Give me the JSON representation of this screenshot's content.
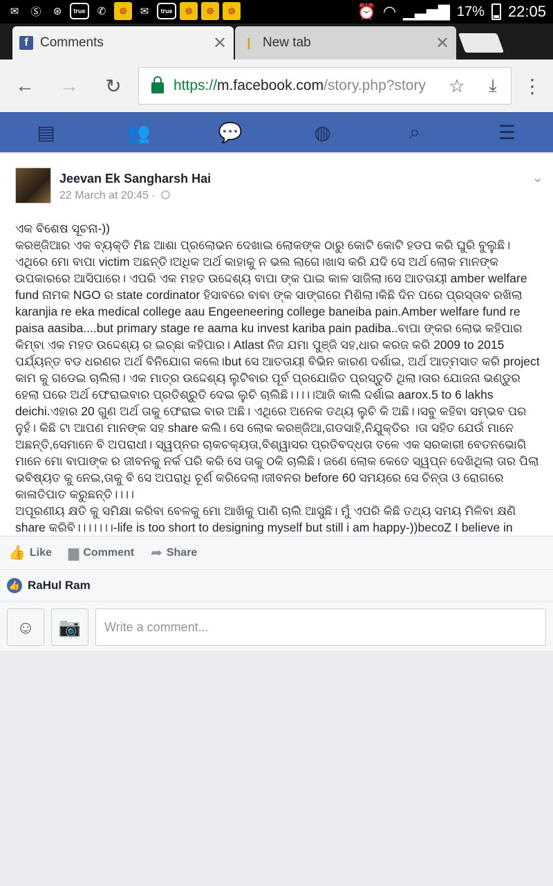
{
  "status_bar": {
    "left_icons": [
      "mail-icon",
      "s-app-icon",
      "game-icon",
      "true-icon",
      "whatsapp-icon",
      "app-icon",
      "mail-at-icon",
      "true-icon",
      "app-icon",
      "app-icon",
      "app-icon"
    ],
    "true_label": "true",
    "battery_pct": "17%",
    "time": "22:05"
  },
  "browser": {
    "tabs": [
      {
        "title": "Comments",
        "favicon": "facebook-icon",
        "active": true
      },
      {
        "title": "New tab",
        "favicon": "chrome-icon",
        "active": false
      }
    ],
    "url_scheme": "https://",
    "url_host": "m.facebook.com",
    "url_path": "/story.php?story"
  },
  "post": {
    "author": "Jeevan Ek Sangharsh Hai",
    "timestamp": "22 March at 20:45 ·",
    "paragraphs": [
      "ଏକ ବିଶେଷ ସୂଚନା-))",
      "କରଞ୍ଜିଆର ଏକ ବ୍ୟକ୍ତି ମିଛ ଆଶା ପ୍ରଲୋଭନ ଦେଖାଇ ଲୋକଙ୍କ ଠାରୁ କୋଟି କୋଟି ହଡପ କରି ଘୁରି ବୁଲୁଛି।",
      "ଏଥିରେ ମୋ ବାପା victim ଅଛନ୍ତି।ଅଧିକ ଅର୍ଥ କାହାକୁ ନ ଭଲ ଲାଗେ।ଖାସ କରି ଯଦି ସେ ଅର୍ଥ ଲୋକ ମାନଙ୍କ ଉପକାରରେ ଆସିପାରେ। ଏପରି ଏକ ମହତ ଉଦ୍ଦେଶ୍ୟ ବାପା ଙ୍କ ପାଇ କାଳ ସାଜିଲା।ସେ ଆତତାୟୀ amber welfare fund ନାମକ NGO ର state cordinator ହିସାବରେ ବାବା ଙ୍କ ସାଙ୍ଗରେ ମିଶିଲା।କିଛି ଦିନ ପରେ ପ୍ରସ୍ତାବ ରଖିଲା karanjia re eka medical college aau Engeeneering college baneiba pain.Amber welfare fund re paisa aasiba....but primary stage re aama ku invest kariba pain padiba..ବାପା ଙ୍କର ଲୋଭ କହିପାର କିମ୍ବା ଏକ ମହତ ଉଦ୍ଦେଶ୍ୟ ର ଇଚ୍ଛା କହିପାର। Atlast ନିଜ ଯମା ପୁଞ୍ଜି ସହ,ଧାର କରଜ କରି 2009 to 2015 ପର୍ଯ୍ୟନ୍ତ ବଡ ଧରଣର ଅର୍ଥ ବିନିଯୋଗ କଲେ।but ସେ ଆତତାୟୀ ବିଭିନ କାରଣ ଦର୍ଶାଇ, ଅର୍ଥ ଆତ୍ମସାତ କରି project କାମ କୁ ଗଡେଇ ଚାଲିଲା। ଏକ ମାତ୍ର ଉଦ୍ଦେଶ୍ୟ ଲୁଟିବାର ପୂର୍ବ ପ୍ରଯୋଜିତ ପ୍ରସ୍ତୁତି ଥିଲା।ତାର ଯୋଜନା ଭଣ୍ଡୁର ହେଲା ପରେ ଅର୍ଥ ଫେରାଇବାର ପ୍ରତିଶ୍ରୁତି ଦେଇ ଲୁଚି ଚାଲିଛି।।।।।ଆଜି କାଲି ଦର୍ଶାଇ aarox.5 to 6 lakhs deichi.ଏହାର 20 ଗୁଣ ଅର୍ଥ ତାକୁ ଫେରାଇ ବାର ଅଛି। ଏଥିରେ ଅନେକ ତଥ୍ୟ ଲୁଚି କି ଅଛି।।ସବୁ କହିବା ସମ୍ଭବ ପର ନୁହଁ। କିଛି ଟା ଆପଣ ମାନଙ୍କ ସହ share କଲି। ସେ ଲୋକ କରଞ୍ଜିଆ,ଗଡସାହି,ନିଯୁକ୍ତିର ।ତା ସହିତ ଯେଉଁ ମାନେ ଅଛନ୍ତି,ସେମାନେ ବି ଅପରାଧୀ। ସ୍ୱପ୍ନର ଚାକଚକ୍ୟତା,ବିଶ୍ୱାସର ପ୍ରତିବଦ୍ଧତା ତଳେ ଏକ ସରକାରୀ ବେତନଭୋଗି ମାନେ ମୋ ବାପାଙ୍କ ର ଜୀବନକୁ ନର୍କ ପରି କରି ସେ ତାକୁ ଠକି ଚାଲିଛି। ଜଣେ ଲୋକ କେତେ ସ୍ୱପ୍ନ ଦେଖିଥିଲା ତାର ପିଲା ଭବିଷ୍ୟତ କୁ ନେଇ,ତାକୁ ବି ସେ ଅପରାଧି ଚୂର୍ଣ କରିଦେଲା।ଜୀବନର before 60 ସମୟରେ ସେ ଚିନ୍ତା ଓ ରୋଗରେ କାଳାତିପାତ କରୁଛନ୍ତି।।।।",
      "ଅପୂରଣୀୟ କ୍ଷତି କୁ ସମିକ୍ଷା କରିବା ବେଳକୁ ମୋ ଆଖିକୁ ପାଣି ଚାଲି ଆସୁଛି। ମୁଁ ଏପରି କିଛି ତଥ୍ୟ ସମୟ ମିଳିବା କ୍ଷଣି share କରିବି।।।।।।।-life is too short to designing myself but still i am happy-))becoZ I believe in myself -))"
    ]
  },
  "actions": {
    "like": "Like",
    "comment": "Comment",
    "share": "Share"
  },
  "likes": {
    "names": "RaHul Ram"
  },
  "composer": {
    "placeholder": "Write a comment..."
  }
}
